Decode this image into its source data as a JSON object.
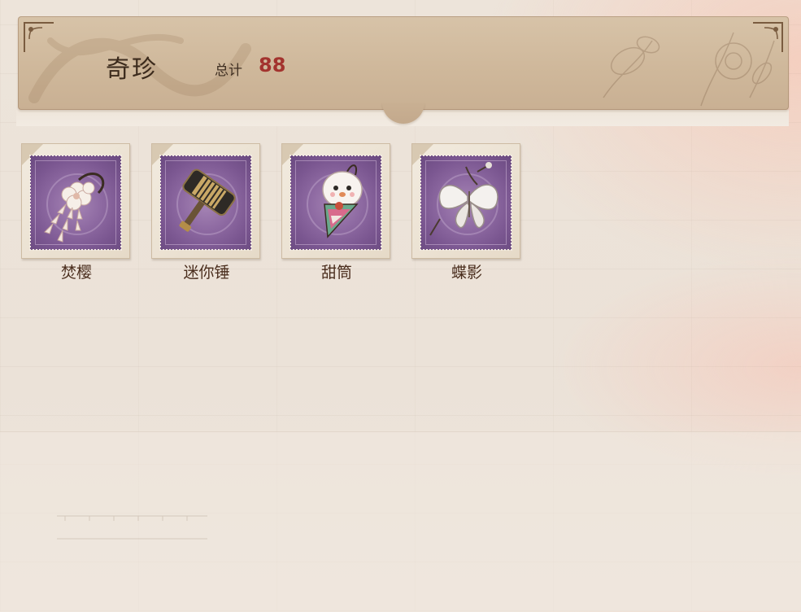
{
  "header": {
    "title": "奇珍",
    "total_label": "总计",
    "total_value": "88"
  },
  "items": [
    {
      "label": "焚樱",
      "icon": "flower-tassel-icon"
    },
    {
      "label": "迷你锤",
      "icon": "mini-hammer-icon"
    },
    {
      "label": "甜筒",
      "icon": "sweet-cone-icon"
    },
    {
      "label": "蝶影",
      "icon": "butterfly-icon"
    }
  ],
  "colors": {
    "title": "#3b2a1c",
    "total_value": "#a3332e",
    "stamp": "#8e6aa2",
    "label": "#4a2d1d"
  }
}
